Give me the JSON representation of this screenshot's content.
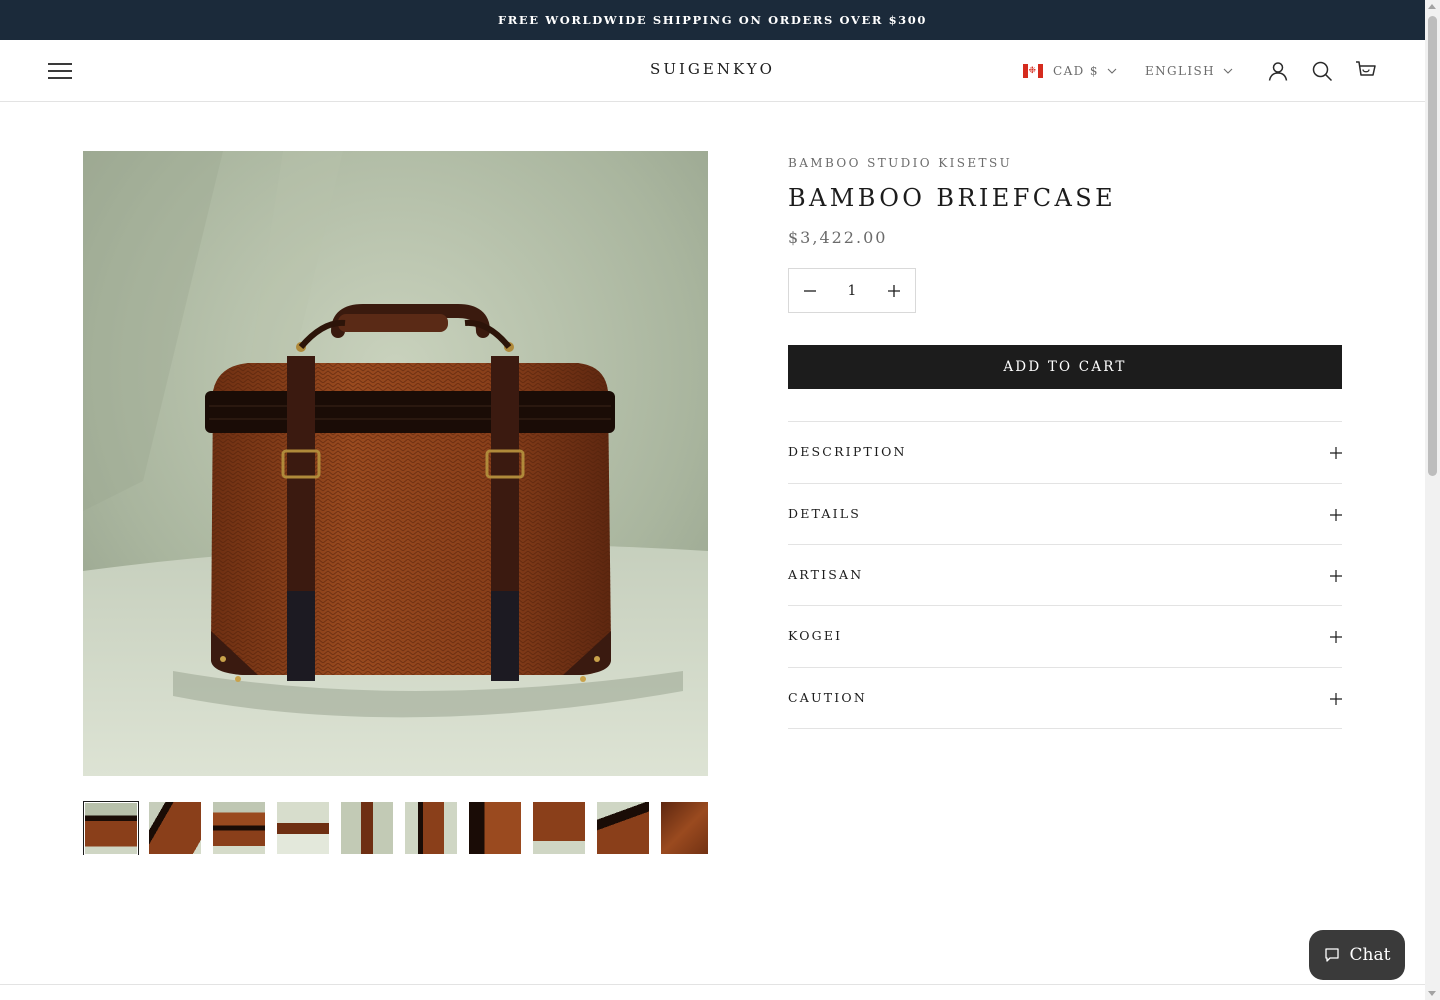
{
  "announcement": "FREE WORLDWIDE SHIPPING ON ORDERS OVER $300",
  "header": {
    "logo": "SUIGENKYO",
    "currency": "CAD $",
    "language": "ENGLISH",
    "icons": [
      "menu-icon",
      "account-icon",
      "search-icon",
      "cart-icon"
    ]
  },
  "product": {
    "vendor": "BAMBOO STUDIO KISETSU",
    "title": "BAMBOO BRIEFCASE",
    "price": "$3,422.00",
    "quantity": "1",
    "add_to_cart": "ADD TO CART"
  },
  "accordion": [
    {
      "label": "DESCRIPTION"
    },
    {
      "label": "DETAILS"
    },
    {
      "label": "ARTISAN"
    },
    {
      "label": "KOGEI"
    },
    {
      "label": "CAUTION"
    }
  ],
  "gallery": {
    "thumbnail_count": 10,
    "active_index": 0
  },
  "chat": {
    "label": "Chat"
  },
  "colors": {
    "announcement_bg": "#1b2a3a",
    "button_bg": "#1c1c1c",
    "chat_bg": "#3a3a3a",
    "product_leather": "#8a3f1a"
  }
}
